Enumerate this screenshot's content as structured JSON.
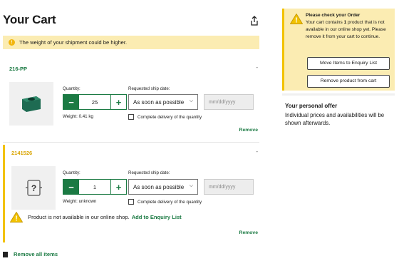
{
  "cart": {
    "title": "Your Cart",
    "weight_warning": "The weight of your shipment could be higher.",
    "remove_all_label": "Remove all items"
  },
  "items": [
    {
      "sku": "216-PP",
      "more": "-",
      "quantity_label": "Quantity:",
      "quantity": "25",
      "ship_date_label": "Requested ship date:",
      "ship_option": "As soon as possible",
      "date_placeholder": "mm/dd/yyyy",
      "complete_delivery_label": "Complete delivery of the quantity",
      "weight": "Weight: 0.41 kg",
      "remove_label": "Remove"
    },
    {
      "sku": "2141526",
      "more": "-",
      "quantity_label": "Quantity:",
      "quantity": "1",
      "ship_date_label": "Requested ship date:",
      "ship_option": "As soon as possible",
      "date_placeholder": "mm/dd/yyyy",
      "complete_delivery_label": "Complete delivery of the quantity",
      "weight": "Weight: unknown",
      "unavailable_text": "Product is not available in our online shop.",
      "enquiry_link": "Add to Enquiry List",
      "remove_label": "Remove"
    }
  ],
  "notice": {
    "title": "Please check your Order",
    "text_before": "Your cart contains ",
    "count": "1",
    "text_after": " product that is not available in our online shop yet. Please remove it from your cart to continue.",
    "move_button": "Move Items to Enquiry List",
    "remove_button": "Remove product from cart"
  },
  "offer": {
    "title": "Your personal offer",
    "text": "Individual prices and availabilities will be shown afterwards."
  },
  "colors": {
    "brand_green": "#1b7a43",
    "warning_yellow": "#f2c200",
    "banner_bg": "#fbecb2"
  }
}
